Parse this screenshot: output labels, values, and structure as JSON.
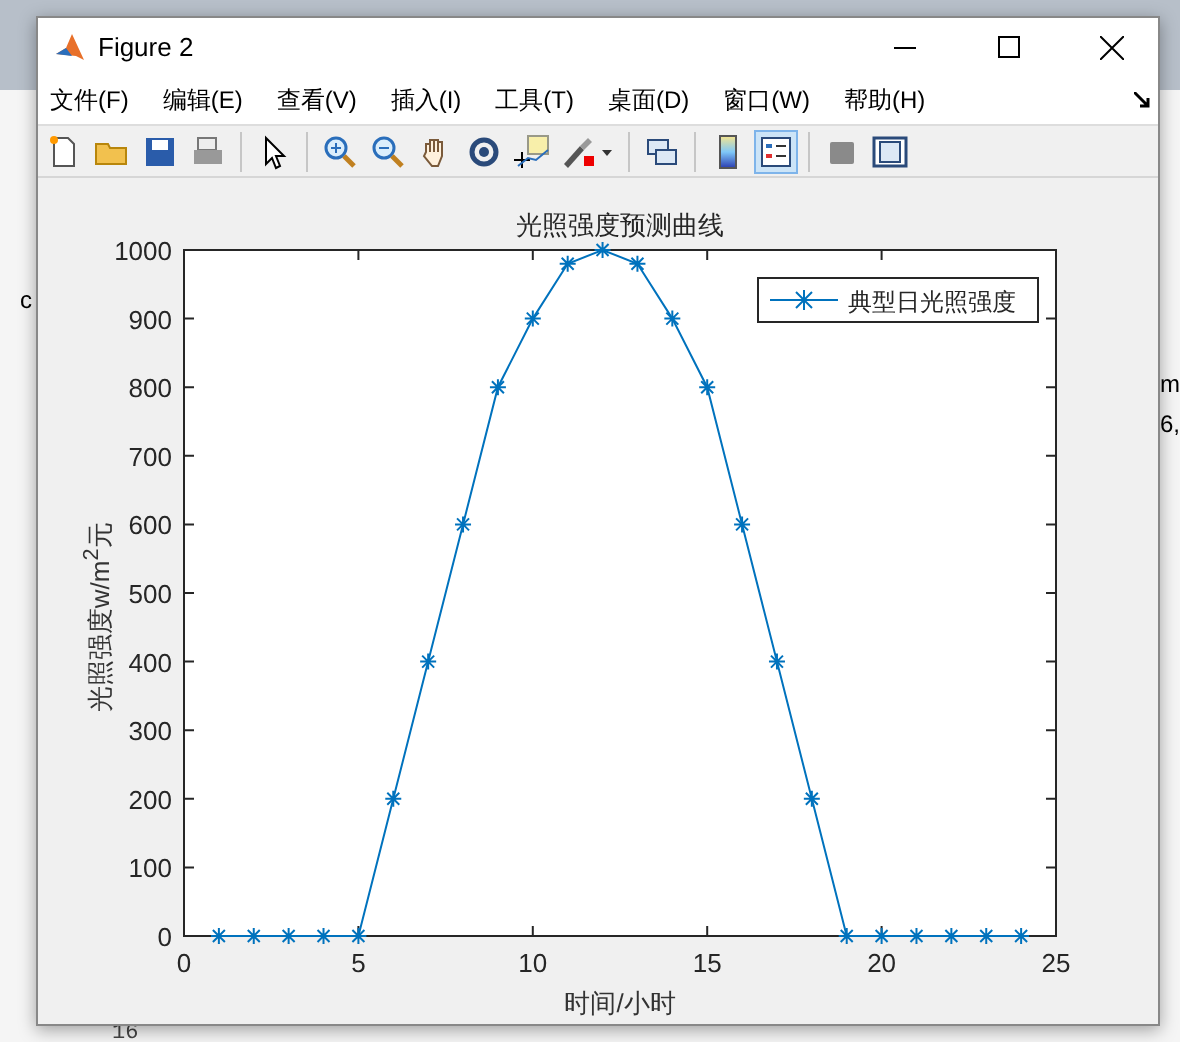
{
  "window": {
    "title": "Figure 2"
  },
  "menu": [
    "文件(F)",
    "编辑(E)",
    "查看(V)",
    "插入(I)",
    "工具(T)",
    "桌面(D)",
    "窗口(W)",
    "帮助(H)"
  ],
  "toolbar": [
    {
      "kind": "new",
      "selected": false
    },
    {
      "kind": "open",
      "selected": false
    },
    {
      "kind": "save",
      "selected": false
    },
    {
      "kind": "print",
      "selected": false
    },
    {
      "kind": "sep"
    },
    {
      "kind": "pointer",
      "selected": false
    },
    {
      "kind": "sep"
    },
    {
      "kind": "zoomin",
      "selected": false
    },
    {
      "kind": "zoomout",
      "selected": false
    },
    {
      "kind": "pan",
      "selected": false
    },
    {
      "kind": "rotate",
      "selected": false
    },
    {
      "kind": "cursor",
      "selected": false
    },
    {
      "kind": "brush",
      "selected": false
    },
    {
      "kind": "sep"
    },
    {
      "kind": "link",
      "selected": false
    },
    {
      "kind": "sep"
    },
    {
      "kind": "colorbar",
      "selected": false
    },
    {
      "kind": "legend",
      "selected": true
    },
    {
      "kind": "sep"
    },
    {
      "kind": "hide",
      "selected": false
    },
    {
      "kind": "tools",
      "selected": false
    }
  ],
  "chart_data": {
    "type": "line",
    "title": "光照强度预测曲线",
    "xlabel": "时间/小时",
    "ylabel": "光照强度w/m$^{2}$元",
    "x": [
      1,
      2,
      3,
      4,
      5,
      6,
      7,
      8,
      9,
      10,
      11,
      12,
      13,
      14,
      15,
      16,
      17,
      18,
      19,
      20,
      21,
      22,
      23,
      24
    ],
    "series": [
      {
        "name": "典型日光照强度",
        "color": "#0072bd",
        "marker": "cross",
        "values": [
          0,
          0,
          0,
          0,
          0,
          200,
          400,
          600,
          800,
          900,
          980,
          1000,
          980,
          900,
          800,
          600,
          400,
          200,
          0,
          0,
          0,
          0,
          0,
          0
        ]
      }
    ],
    "xlim": [
      0,
      25
    ],
    "ylim": [
      0,
      1000
    ],
    "xticks": [
      0,
      5,
      10,
      15,
      20,
      25
    ],
    "yticks": [
      0,
      100,
      200,
      300,
      400,
      500,
      600,
      700,
      800,
      900,
      1000
    ]
  },
  "background": {
    "left_fragment": "c",
    "right_fragments": [
      "m",
      "6,"
    ],
    "code_line": {
      "number": "16"
    }
  }
}
